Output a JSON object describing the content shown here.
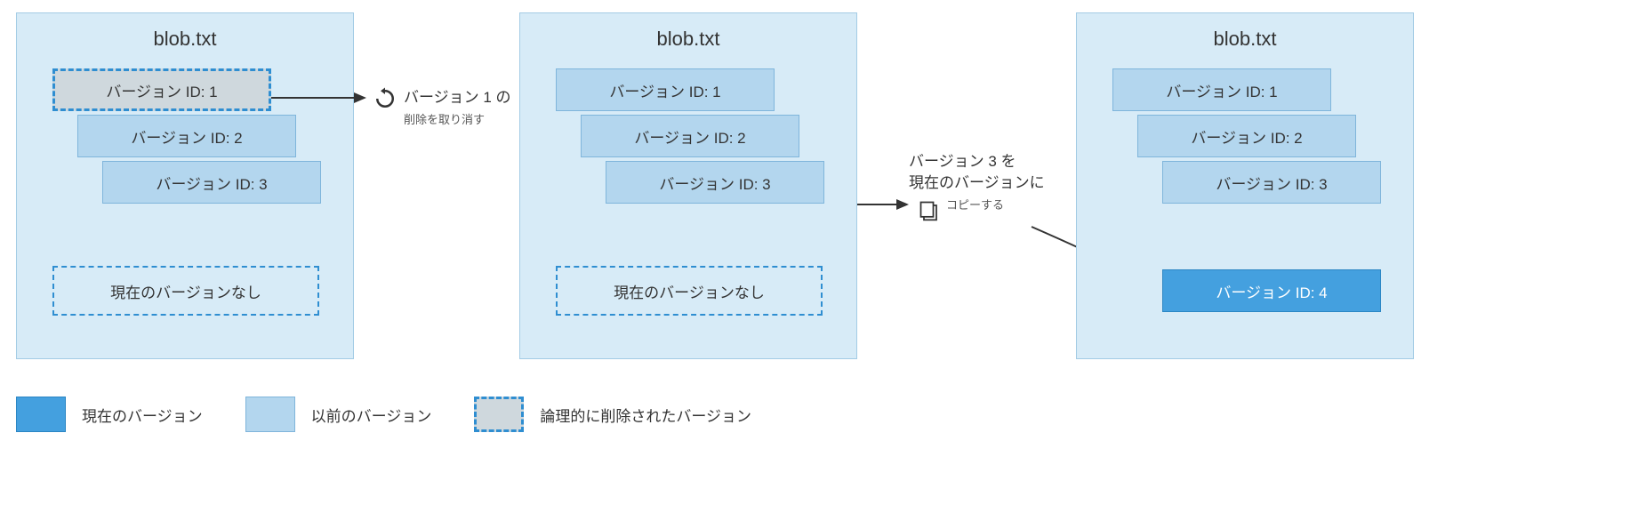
{
  "panels": [
    {
      "title": "blob.txt"
    },
    {
      "title": "blob.txt"
    },
    {
      "title": "blob.txt"
    }
  ],
  "versionLabels": {
    "v1": "バージョン ID: 1",
    "v2": "バージョン ID: 2",
    "v3": "バージョン ID: 3",
    "v4": "バージョン ID: 4"
  },
  "noCurrent": "現在のバージョンなし",
  "steps": {
    "undelete": {
      "main": "バージョン 1 の",
      "sub": "削除を取り消す"
    },
    "copy": {
      "main1": "バージョン 3 を",
      "main2": "現在のバージョンに",
      "sub": "コピーする"
    }
  },
  "legend": {
    "current": "現在のバージョン",
    "previous": "以前のバージョン",
    "deleted": "論理的に削除されたバージョン"
  }
}
